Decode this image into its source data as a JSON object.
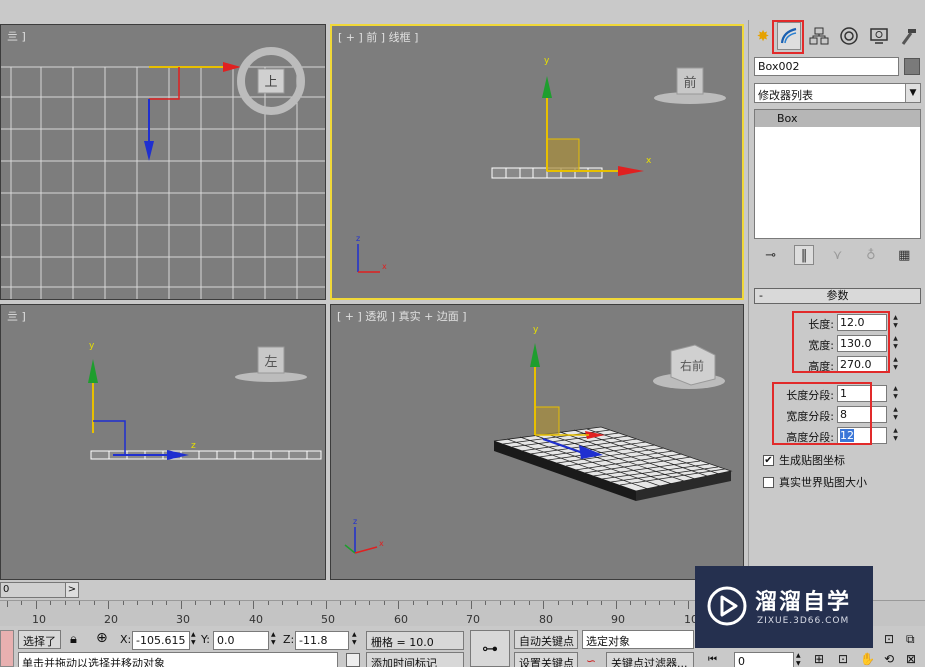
{
  "viewports": {
    "top": {
      "label": "亖 ]",
      "cube_label": "上"
    },
    "front": {
      "label": "[ + ] 前 ] 线框 ]",
      "cube_label": "前"
    },
    "left": {
      "label": "亖 ]",
      "cube_label": "左"
    },
    "perspective": {
      "label": "[ + ] 透视 ] 真实 + 边面 ]",
      "cube_label": "右前"
    },
    "axis_x": "x",
    "axis_y": "y",
    "axis_z": "z"
  },
  "command_panel": {
    "tabs": [
      {
        "name": "create-tab",
        "icon": "star-icon"
      },
      {
        "name": "modify-tab",
        "icon": "modify-icon",
        "selected": true
      },
      {
        "name": "hierarchy-tab",
        "icon": "hierarchy-icon"
      },
      {
        "name": "motion-tab",
        "icon": "motion-icon"
      },
      {
        "name": "display-tab",
        "icon": "display-icon"
      },
      {
        "name": "utilities-tab",
        "icon": "hammer-icon"
      }
    ],
    "object_name": "Box002",
    "object_color": "#7a7a7a",
    "modifier_list": "修改器列表",
    "stack_items": [
      "Box"
    ],
    "rollout_title": "参数",
    "rollout_toggle": "-",
    "params": {
      "length_label": "长度:",
      "length_value": "12.0",
      "width_label": "宽度:",
      "width_value": "130.0",
      "height_label": "高度:",
      "height_value": "270.0",
      "length_segs_label": "长度分段:",
      "length_segs_value": "1",
      "width_segs_label": "宽度分段:",
      "width_segs_value": "8",
      "height_segs_label": "高度分段:",
      "height_segs_value": "12"
    },
    "gen_mapping": {
      "label": "生成贴图坐标",
      "checked": true
    },
    "real_world": {
      "label": "真实世界贴图大小",
      "checked": false
    }
  },
  "timeline": {
    "slider_text": "0",
    "slider_arrow": ">",
    "ticks": [
      "10",
      "20",
      "30",
      "40",
      "50",
      "60",
      "70",
      "80",
      "90",
      "10"
    ]
  },
  "status_bar": {
    "selected_text": "选择了",
    "prompt_text": "单击并拖动以选择并移动对象",
    "x_label": "X:",
    "x_value": "-105.615",
    "y_label": "Y:",
    "y_value": "0.0",
    "z_label": "Z:",
    "z_value": "-11.8",
    "grid_text": "栅格 = 10.0",
    "add_time_tag": "添加时间标记",
    "auto_key": "自动关键点",
    "set_key": "设置关键点",
    "selected_object": "选定对象",
    "key_filters": "关键点过滤器...",
    "frame_value": "0"
  },
  "watermark": {
    "title": "溜溜自学",
    "url": "ZIXUE.3D66.COM"
  },
  "colors": {
    "viewport_bg": "#7d7d7d",
    "active_border": "#f0d838",
    "highlight_red": "#e12a2a",
    "axis_x": "#e02020",
    "axis_y": "#1e9e2e",
    "axis_z": "#1f2fd0",
    "gizmo_yellow": "#e8c000",
    "watermark_bg": "#25304f"
  }
}
